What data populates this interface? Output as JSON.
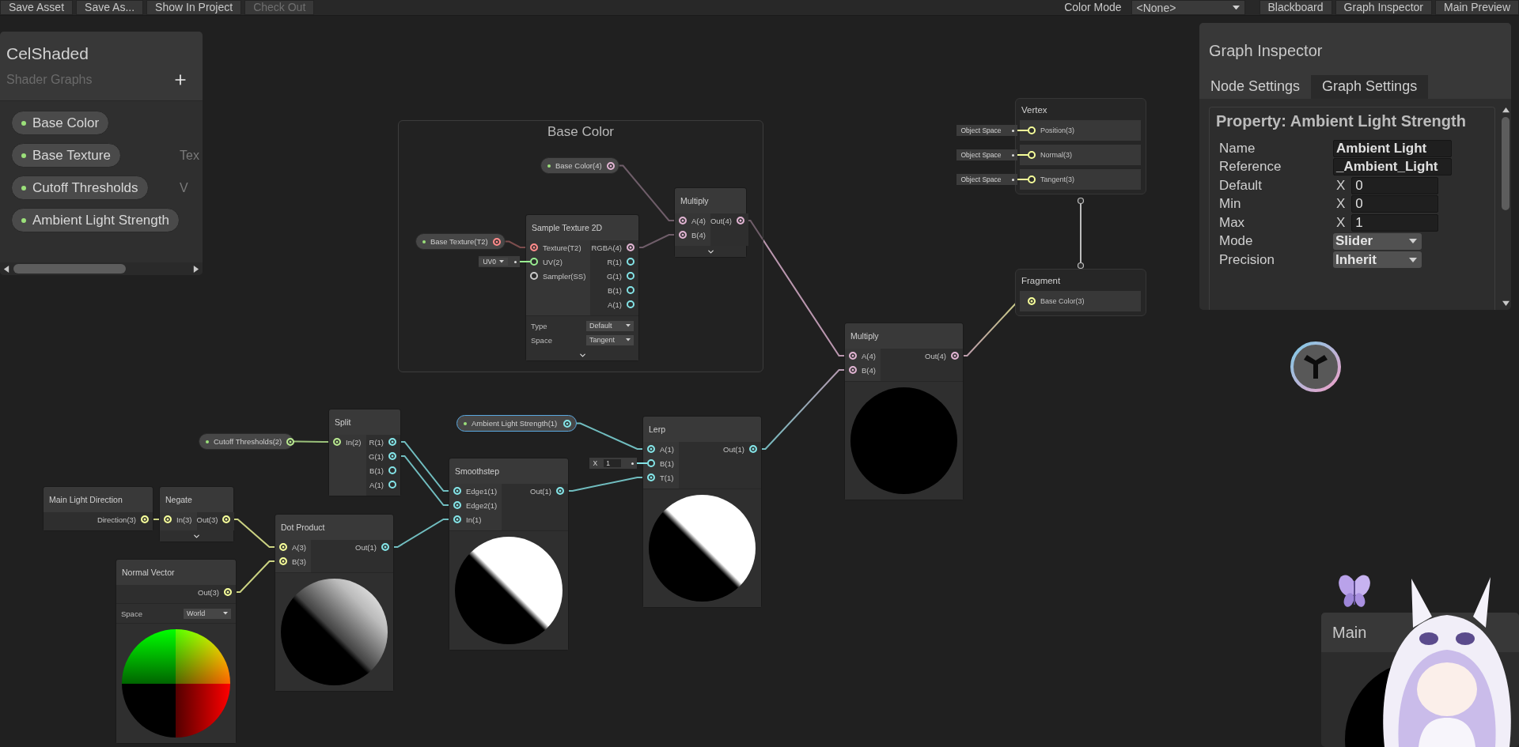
{
  "toolbar": {
    "buttons": [
      {
        "label": "Save Asset",
        "disabled": false
      },
      {
        "label": "Save As...",
        "disabled": false
      },
      {
        "label": "Show In Project",
        "disabled": false
      },
      {
        "label": "Check Out",
        "disabled": true
      }
    ],
    "color_mode": {
      "label": "Color Mode",
      "value": "<None>"
    },
    "toggles": [
      {
        "label": "Blackboard"
      },
      {
        "label": "Graph Inspector"
      },
      {
        "label": "Main Preview"
      }
    ]
  },
  "blackboard": {
    "title": "CelShaded",
    "subtitle": "Shader Graphs",
    "properties": [
      {
        "name": "Base Color"
      },
      {
        "name": "Base Texture",
        "type": "Tex"
      },
      {
        "name": "Cutoff Thresholds",
        "type": "V"
      },
      {
        "name": "Ambient Light Strength"
      }
    ]
  },
  "groups": [
    {
      "title": "Base Color"
    }
  ],
  "nodes": [
    {
      "kind": "property",
      "label": "Base Color(4)",
      "selected": false,
      "outputs": [
        {
          "connected": true,
          "color": "#e0b4d2"
        }
      ]
    },
    {
      "kind": "property",
      "label": "Base Texture(T2)",
      "selected": false,
      "outputs": [
        {
          "connected": true,
          "color": "#ff8b8b"
        }
      ]
    },
    {
      "kind": "node",
      "title": "Multiply",
      "selected": false,
      "collapsible": true,
      "inputs": [
        {
          "label": "A(4)",
          "connected": true,
          "color": "#e0b4d2"
        },
        {
          "label": "B(4)",
          "connected": true,
          "color": "#e0b4d2"
        }
      ],
      "outputs": [
        {
          "label": "Out(4)",
          "connected": true,
          "color": "#e0b4d2"
        }
      ]
    },
    {
      "kind": "node",
      "title": "Sample Texture 2D",
      "selected": false,
      "collapsible": true,
      "inputs": [
        {
          "label": "Texture(T2)",
          "connected": true,
          "color": "#ff8b8b"
        },
        {
          "label": "UV(2)",
          "connected": false,
          "color": "#9aef92",
          "default": {
            "kind": "dropdown",
            "value": "UV0"
          }
        },
        {
          "label": "Sampler(SS)",
          "connected": false,
          "color": "#cccccc"
        }
      ],
      "outputs": [
        {
          "label": "RGBA(4)",
          "connected": true,
          "color": "#e0b4d2"
        },
        {
          "label": "R(1)",
          "connected": false,
          "color": "#84e4e7"
        },
        {
          "label": "G(1)",
          "connected": false,
          "color": "#84e4e7"
        },
        {
          "label": "B(1)",
          "connected": false,
          "color": "#84e4e7"
        },
        {
          "label": "A(1)",
          "connected": false,
          "color": "#84e4e7"
        }
      ],
      "settings": [
        {
          "label": "Type",
          "value": "Default"
        },
        {
          "label": "Space",
          "value": "Tangent"
        }
      ]
    },
    {
      "kind": "block",
      "title": "Vertex",
      "selected": false,
      "inputs": [
        {
          "label": "Position(3)",
          "connected": false,
          "color": "#f6ff9a",
          "default": {
            "kind": "tag",
            "value": "Object Space"
          }
        },
        {
          "label": "Normal(3)",
          "connected": false,
          "color": "#f6ff9a",
          "default": {
            "kind": "tag",
            "value": "Object Space"
          }
        },
        {
          "label": "Tangent(3)",
          "connected": false,
          "color": "#f6ff9a",
          "default": {
            "kind": "tag",
            "value": "Object Space"
          }
        }
      ]
    },
    {
      "kind": "block",
      "title": "Fragment",
      "selected": false,
      "inputs": [
        {
          "label": "Base Color(3)",
          "connected": true,
          "color": "#f6ff9a"
        }
      ]
    },
    {
      "kind": "node",
      "title": "Multiply",
      "selected": false,
      "inputs": [
        {
          "label": "A(4)",
          "connected": true,
          "color": "#e0b4d2"
        },
        {
          "label": "B(4)",
          "connected": true,
          "color": "#e0b4d2"
        }
      ],
      "outputs": [
        {
          "label": "Out(4)",
          "connected": true,
          "color": "#e0b4d2"
        }
      ],
      "preview": {
        "kind": "black"
      }
    },
    {
      "kind": "property",
      "label": "Ambient Light Strength(1)",
      "selected": true,
      "outputs": [
        {
          "connected": true,
          "color": "#84e4e7"
        }
      ]
    },
    {
      "kind": "node",
      "title": "Lerp",
      "selected": false,
      "inputs": [
        {
          "label": "A(1)",
          "connected": true,
          "color": "#84e4e7"
        },
        {
          "label": "B(1)",
          "connected": false,
          "color": "#84e4e7",
          "default": {
            "kind": "number",
            "prefix": "X",
            "value": "1"
          }
        },
        {
          "label": "T(1)",
          "connected": true,
          "color": "#84e4e7"
        }
      ],
      "outputs": [
        {
          "label": "Out(1)",
          "connected": true,
          "color": "#84e4e7"
        }
      ],
      "preview": {
        "kind": "split"
      }
    },
    {
      "kind": "node",
      "title": "Smoothstep",
      "selected": false,
      "inputs": [
        {
          "label": "Edge1(1)",
          "connected": true,
          "color": "#84e4e7"
        },
        {
          "label": "Edge2(1)",
          "connected": true,
          "color": "#84e4e7"
        },
        {
          "label": "In(1)",
          "connected": true,
          "color": "#84e4e7"
        }
      ],
      "outputs": [
        {
          "label": "Out(1)",
          "connected": true,
          "color": "#84e4e7"
        }
      ],
      "preview": {
        "kind": "split"
      }
    },
    {
      "kind": "node",
      "title": "Split",
      "selected": false,
      "inputs": [
        {
          "label": "In(2)",
          "connected": true,
          "color": "#b8e890"
        }
      ],
      "outputs": [
        {
          "label": "R(1)",
          "connected": true,
          "color": "#84e4e7"
        },
        {
          "label": "G(1)",
          "connected": true,
          "color": "#84e4e7"
        },
        {
          "label": "B(1)",
          "connected": false,
          "color": "#84e4e7"
        },
        {
          "label": "A(1)",
          "connected": false,
          "color": "#84e4e7"
        }
      ]
    },
    {
      "kind": "property",
      "label": "Cutoff Thresholds(2)",
      "selected": false,
      "outputs": [
        {
          "connected": true,
          "color": "#b8e890"
        }
      ]
    },
    {
      "kind": "node",
      "title": "Main Light Direction",
      "selected": false,
      "outputs": [
        {
          "label": "Direction(3)",
          "connected": true,
          "color": "#f6ff9a"
        }
      ]
    },
    {
      "kind": "node",
      "title": "Negate",
      "selected": false,
      "collapsible": true,
      "inputs": [
        {
          "label": "In(3)",
          "connected": true,
          "color": "#f6ff9a"
        }
      ],
      "outputs": [
        {
          "label": "Out(3)",
          "connected": true,
          "color": "#f6ff9a"
        }
      ]
    },
    {
      "kind": "node",
      "title": "Dot Product",
      "selected": false,
      "inputs": [
        {
          "label": "A(3)",
          "connected": true,
          "color": "#f6ff9a"
        },
        {
          "label": "B(3)",
          "connected": true,
          "color": "#f6ff9a"
        }
      ],
      "outputs": [
        {
          "label": "Out(1)",
          "connected": true,
          "color": "#84e4e7"
        }
      ],
      "preview": {
        "kind": "gradient"
      }
    },
    {
      "kind": "node",
      "title": "Normal Vector",
      "selected": false,
      "outputs": [
        {
          "label": "Out(3)",
          "connected": true,
          "color": "#f6ff9a"
        }
      ],
      "settings": [
        {
          "label": "Space",
          "value": "World"
        }
      ],
      "preview": {
        "kind": "normal"
      }
    }
  ],
  "graph_inspector": {
    "title": "Graph Inspector",
    "tabs": [
      {
        "label": "Node Settings",
        "selected": true
      },
      {
        "label": "Graph Settings",
        "selected": false
      }
    ],
    "section_title": "Property: Ambient Light Strength",
    "fields": [
      {
        "label": "Name",
        "kind": "text",
        "value": "Ambient Light"
      },
      {
        "label": "Reference",
        "kind": "text",
        "value": "_Ambient_Light"
      },
      {
        "label": "Default",
        "kind": "number",
        "prefix": "X",
        "value": "0"
      },
      {
        "label": "Min",
        "kind": "number",
        "prefix": "X",
        "value": "0"
      },
      {
        "label": "Max",
        "kind": "number",
        "prefix": "X",
        "value": "1"
      },
      {
        "label": "Mode",
        "kind": "dropdown",
        "value": "Slider"
      },
      {
        "label": "Precision",
        "kind": "dropdown",
        "value": "Inherit"
      }
    ]
  },
  "main_preview": {
    "title": "Main"
  }
}
